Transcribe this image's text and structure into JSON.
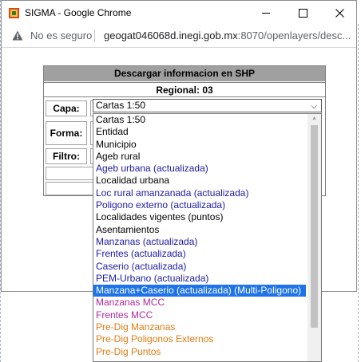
{
  "browser": {
    "window_title": "SIGMA - Google Chrome",
    "security_label": "No es seguro",
    "url_host": "geogat046068d.inegi.gob.mx",
    "url_path": ":8070/openlayers/desc..."
  },
  "panel": {
    "header": "Descargar informacion en SHP",
    "regional": "Regional: 03",
    "capa_label": "Capa:",
    "forma_label": "Forma:",
    "filtro_label": "Filtro:"
  },
  "select": {
    "value": "Cartas 1:50",
    "arrow_icon": "chevron-down-icon"
  },
  "options": [
    {
      "label": "Cartas 1:50",
      "color": "#000000"
    },
    {
      "label": "Entidad",
      "color": "#000000"
    },
    {
      "label": "Municipio",
      "color": "#000000"
    },
    {
      "label": "Ageb rural",
      "color": "#000000"
    },
    {
      "label": "Ageb urbana (actualizada)",
      "color": "#1a1aa6"
    },
    {
      "label": "Localidad urbana",
      "color": "#000000"
    },
    {
      "label": "Loc rural amanzanada (actualizada)",
      "color": "#1a1aa6"
    },
    {
      "label": "Poligono externo (actualizada)",
      "color": "#1a1aa6"
    },
    {
      "label": "Localidades vigentes (puntos)",
      "color": "#000000"
    },
    {
      "label": "Asentamientos",
      "color": "#000000"
    },
    {
      "label": "Manzanas (actualizada)",
      "color": "#1a1aa6"
    },
    {
      "label": "Frentes (actualizada)",
      "color": "#1a1aa6"
    },
    {
      "label": "Caserio (actualizada)",
      "color": "#1a1aa6"
    },
    {
      "label": "PEM-Urbano (actualizada)",
      "color": "#1a1aa6"
    },
    {
      "label": "Manzana+Caserio (actualizada) (Multi-Poligono)",
      "color": "#ffffff",
      "selected": true
    },
    {
      "label": "Manzanas MCC",
      "color": "#b0299e"
    },
    {
      "label": "Frentes MCC",
      "color": "#b0299e"
    },
    {
      "label": "Pre-Dig Manzanas",
      "color": "#e07b14"
    },
    {
      "label": "Pre-Dig Poligonos Externos",
      "color": "#e07b14"
    },
    {
      "label": "Pre-Dig Puntos",
      "color": "#e07b14"
    }
  ]
}
